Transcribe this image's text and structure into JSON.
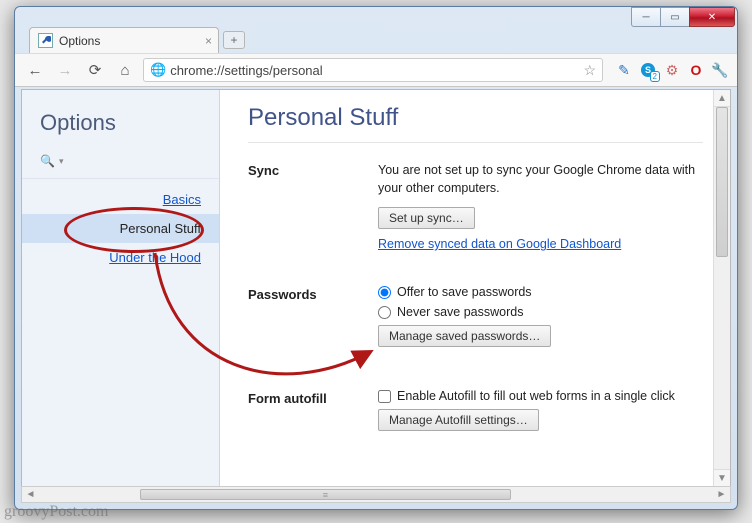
{
  "window": {
    "tab_title": "Options",
    "url": "chrome://settings/personal"
  },
  "toolbar_ext_badge": "2",
  "sidebar": {
    "title": "Options",
    "search_placeholder": "",
    "items": [
      {
        "label": "Basics"
      },
      {
        "label": "Personal Stuff"
      },
      {
        "label": "Under the Hood"
      }
    ]
  },
  "page": {
    "title": "Personal Stuff",
    "sync": {
      "heading": "Sync",
      "desc": "You are not set up to sync your Google Chrome data with your other computers.",
      "setup_btn": "Set up sync…",
      "remove_link": "Remove synced data on Google Dashboard"
    },
    "passwords": {
      "heading": "Passwords",
      "opt_offer": "Offer to save passwords",
      "opt_never": "Never save passwords",
      "manage_btn": "Manage saved passwords…"
    },
    "autofill": {
      "heading": "Form autofill",
      "checkbox": "Enable Autofill to fill out web forms in a single click",
      "manage_btn": "Manage Autofill settings…"
    }
  },
  "watermark": "groovyPost.com"
}
